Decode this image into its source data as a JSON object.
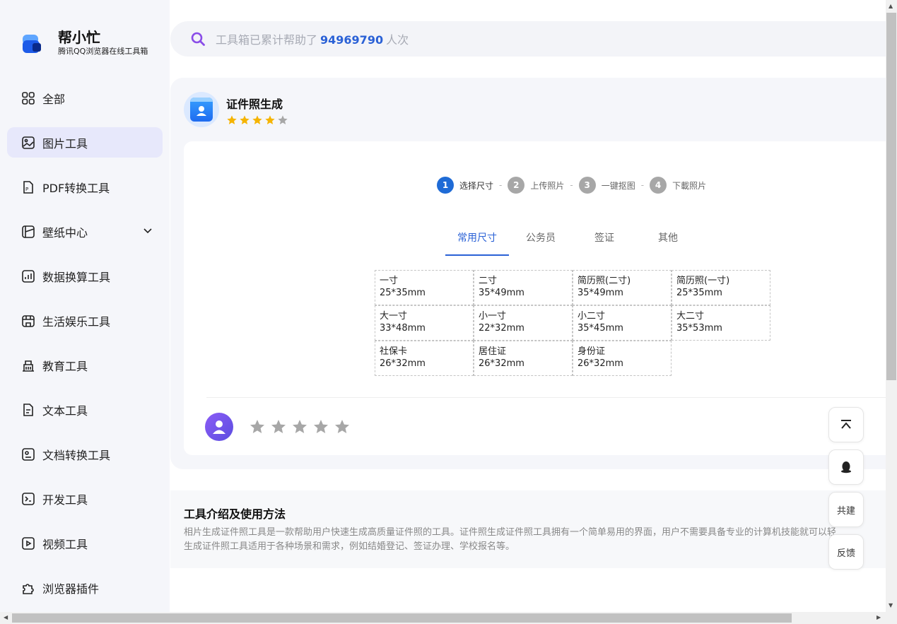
{
  "brand": {
    "title": "帮小忙",
    "subtitle": "腾讯QQ浏览器在线工具箱"
  },
  "sidebar": {
    "items": [
      {
        "label": "全部",
        "icon": "grid-icon"
      },
      {
        "label": "图片工具",
        "icon": "image-icon",
        "active": true
      },
      {
        "label": "PDF转换工具",
        "icon": "pdf-icon"
      },
      {
        "label": "壁纸中心",
        "icon": "wallpaper-icon",
        "expandable": true
      },
      {
        "label": "数据换算工具",
        "icon": "chart-icon"
      },
      {
        "label": "生活娱乐工具",
        "icon": "store-icon"
      },
      {
        "label": "教育工具",
        "icon": "building-icon"
      },
      {
        "label": "文本工具",
        "icon": "document-icon"
      },
      {
        "label": "文档转换工具",
        "icon": "document-convert-icon"
      },
      {
        "label": "开发工具",
        "icon": "terminal-icon"
      },
      {
        "label": "视频工具",
        "icon": "play-icon"
      },
      {
        "label": "浏览器插件",
        "icon": "puzzle-icon"
      }
    ]
  },
  "search": {
    "prefix": "工具箱已累计帮助了",
    "count": "94969790",
    "suffix": "人次"
  },
  "tool": {
    "name": "证件照生成",
    "rating": 4
  },
  "steps": [
    {
      "num": "1",
      "label": "选择尺寸",
      "active": true
    },
    {
      "num": "2",
      "label": "上传照片"
    },
    {
      "num": "3",
      "label": "一键抠图"
    },
    {
      "num": "4",
      "label": "下載照片"
    }
  ],
  "step_separator": "-",
  "tabs": [
    {
      "label": "常用尺寸",
      "active": true
    },
    {
      "label": "公务员"
    },
    {
      "label": "签证"
    },
    {
      "label": "其他"
    }
  ],
  "sizes": [
    {
      "name": "一寸",
      "size": "25*35mm"
    },
    {
      "name": "二寸",
      "size": "35*49mm"
    },
    {
      "name": "简历照(二寸)",
      "size": "35*49mm"
    },
    {
      "name": "简历照(一寸)",
      "size": "25*35mm"
    },
    {
      "name": "大一寸",
      "size": "33*48mm"
    },
    {
      "name": "小一寸",
      "size": "22*32mm"
    },
    {
      "name": "小二寸",
      "size": "35*45mm"
    },
    {
      "name": "大二寸",
      "size": "35*53mm"
    },
    {
      "name": "社保卡",
      "size": "26*32mm"
    },
    {
      "name": "居住证",
      "size": "26*32mm"
    },
    {
      "name": "身份证",
      "size": "26*32mm"
    }
  ],
  "user_rating": 0,
  "intro": {
    "title": "工具介绍及使用方法",
    "line1": "相片生成证件照工具是一款帮助用户快速生成高质量证件照的工具。证件照生成证件照工具拥有一个简单易用的界面，用户不需要具备专业的计算机技能就可以轻",
    "line2": "生成证件照工具适用于各种场景和需求，例如结婚登记、签证办理、学校报名等。"
  },
  "float_buttons": {
    "top_icon": "back-to-top-icon",
    "qq_icon": "qq-penguin-icon",
    "cobuild": "共建",
    "feedback": "反馈"
  },
  "colors": {
    "accent": "#2a61d6",
    "active_nav_bg": "#e7e8fb",
    "star_gold": "#f5b400",
    "star_gray": "#a7a7a7"
  }
}
